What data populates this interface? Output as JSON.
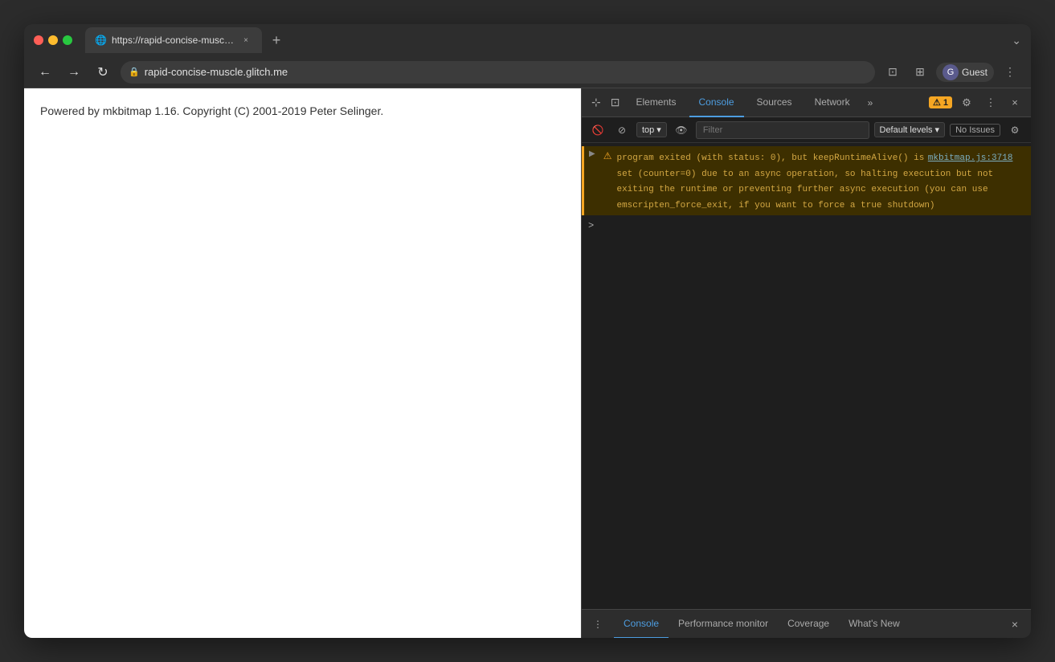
{
  "browser": {
    "tab": {
      "favicon": "🌐",
      "title": "https://rapid-concise-muscle.g...",
      "close_label": "×"
    },
    "new_tab_label": "+",
    "dropdown_label": "⌄",
    "nav": {
      "back_label": "←",
      "forward_label": "→",
      "reload_label": "↻",
      "lock_label": "🔒",
      "address": "rapid-concise-muscle.glitch.me",
      "cast_label": "⊡",
      "screen_label": "⊞",
      "profile_label": "Guest",
      "more_label": "⋮"
    }
  },
  "webpage": {
    "content": "Powered by mkbitmap 1.16. Copyright (C) 2001-2019 Peter Selinger."
  },
  "devtools": {
    "tabs": [
      {
        "label": "Elements",
        "active": false
      },
      {
        "label": "Console",
        "active": true
      },
      {
        "label": "Sources",
        "active": false
      },
      {
        "label": "Network",
        "active": false
      }
    ],
    "more_tabs_label": "»",
    "warning_count": "1",
    "settings_label": "⚙",
    "more_label": "⋮",
    "close_label": "×",
    "toolbar": {
      "clear_label": "🚫",
      "stop_label": "⊘",
      "context": "top",
      "context_arrow": "▾",
      "eye_label": "👁",
      "filter_placeholder": "Filter",
      "levels_label": "Default levels",
      "levels_arrow": "▾",
      "no_issues_label": "No Issues",
      "settings_label": "⚙"
    },
    "console": {
      "warning": {
        "expand": "▶",
        "triangle": "⚠",
        "message_line1": "program exited (with status: 0), but keepRuntimeAlive() is",
        "message_line2": "set (counter=0) due to an async operation, so halting execution but not",
        "message_line3": "exiting the runtime or preventing further async execution (you can use",
        "message_line4": "emscripten_force_exit, if you want to force a true shutdown)",
        "source_link": "mkbitmap.js:3718"
      },
      "prompt_arrow": ">"
    },
    "drawer": {
      "menu_label": "⋮",
      "tabs": [
        {
          "label": "Console",
          "active": true
        },
        {
          "label": "Performance monitor",
          "active": false
        },
        {
          "label": "Coverage",
          "active": false
        },
        {
          "label": "What's New",
          "active": false
        }
      ],
      "close_label": "×"
    }
  },
  "icons": {
    "cursor": "⊹",
    "inspect": "⊡"
  }
}
